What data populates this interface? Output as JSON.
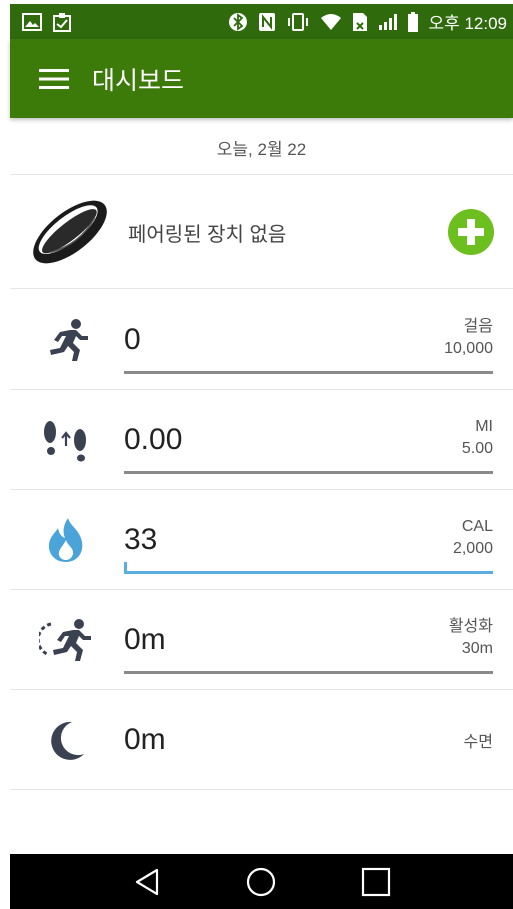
{
  "status_bar": {
    "time": "오후 12:09",
    "icons": [
      "image-icon",
      "clipboard-check-icon",
      "bluetooth-icon",
      "nfc-icon",
      "vibrate-icon",
      "wifi-icon",
      "sim-off-icon",
      "signal-icon",
      "battery-icon"
    ]
  },
  "app_bar": {
    "title": "대시보드",
    "menu_icon": "hamburger-menu-icon"
  },
  "date_label": "오늘, 2월 22",
  "device": {
    "label": "페어링된 장치 없음",
    "add_icon": "add-circle-icon",
    "band_icon": "fitness-band-icon"
  },
  "metrics": [
    {
      "id": "steps",
      "icon": "running-person-icon",
      "value": "0",
      "unit": "걸음",
      "goal": "10,000",
      "progress": 0.0,
      "color": "#8a8a8a"
    },
    {
      "id": "distance",
      "icon": "footsteps-icon",
      "value": "0.00",
      "unit": "MI",
      "goal": "5.00",
      "progress": 0.0,
      "color": "#8a8a8a"
    },
    {
      "id": "calories",
      "icon": "flame-icon",
      "value": "33",
      "unit": "CAL",
      "goal": "2,000",
      "progress": 0.0165,
      "color": "#5aaede"
    },
    {
      "id": "active",
      "icon": "active-timer-icon",
      "value": "0m",
      "unit": "활성화",
      "goal": "30m",
      "progress": 0.0,
      "color": "#8a8a8a"
    },
    {
      "id": "sleep",
      "icon": "moon-icon",
      "value": "0m",
      "unit": "수면",
      "goal": "",
      "progress": null,
      "color": ""
    }
  ],
  "nav_bar": {
    "back_icon": "back-triangle-icon",
    "home_icon": "home-circle-icon",
    "recents_icon": "recents-square-icon"
  },
  "colors": {
    "status_bar": "#2f6b0d",
    "app_bar": "#3c7a0a",
    "add_button": "#6cbf1e",
    "icon_dark": "#3a4150",
    "flame": "#4aa3d9"
  }
}
